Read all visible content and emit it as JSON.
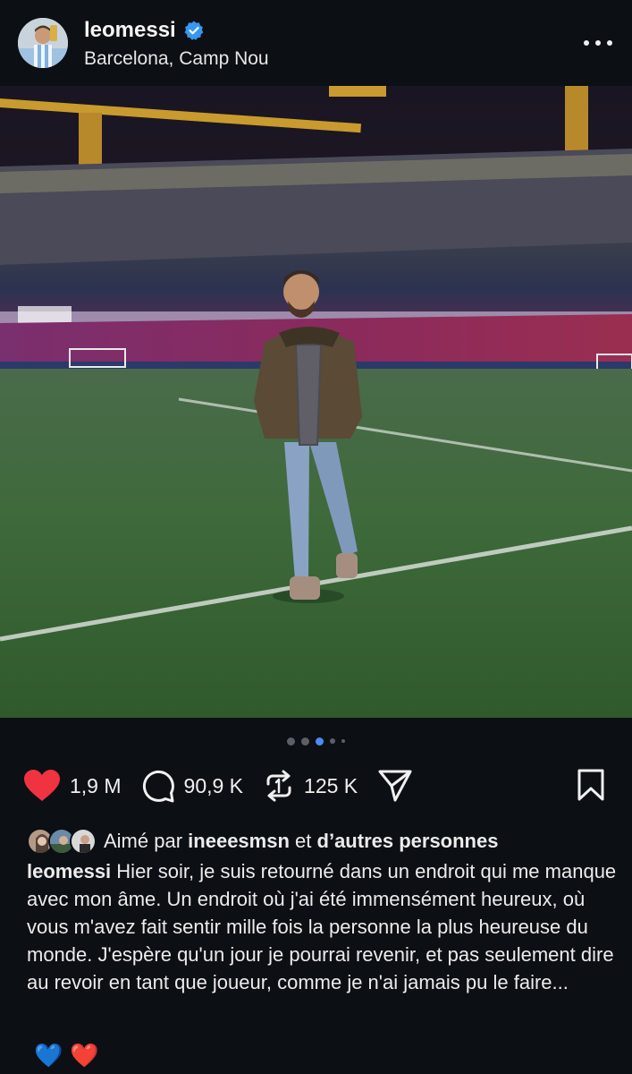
{
  "post": {
    "username": "leomessi",
    "location": "Barcelona, Camp Nou",
    "verified": true
  },
  "carousel": {
    "total": 5,
    "active_index": 2
  },
  "actions": {
    "likes": "1,9 M",
    "comments": "90,9 K",
    "reposts": "125 K"
  },
  "liked_by": {
    "prefix": "Aimé par",
    "user": "ineeesmsn",
    "connector": "et",
    "others": "d’autres personnes"
  },
  "caption": {
    "username": "leomessi",
    "text": "Hier soir, je suis retourné dans un endroit qui me manque avec mon âme. Un endroit où j'ai été immensément heureux, où vous m'avez fait sentir mille fois la personne la plus heureuse du monde. J'espère qu'un jour je pourrai revenir, et pas seulement dire au revoir en tant que joueur, comme je n'ai jamais pu le faire...",
    "emojis": [
      "💙",
      "❤️"
    ]
  },
  "colors": {
    "background": "#0c0f14",
    "like_red": "#ef3340",
    "verified_blue": "#3897f0",
    "active_dot": "#4a8cf0"
  },
  "icons": [
    "heart-icon",
    "comment-icon",
    "repost-icon",
    "share-icon",
    "bookmark-icon",
    "more-icon",
    "verified-badge-icon"
  ]
}
